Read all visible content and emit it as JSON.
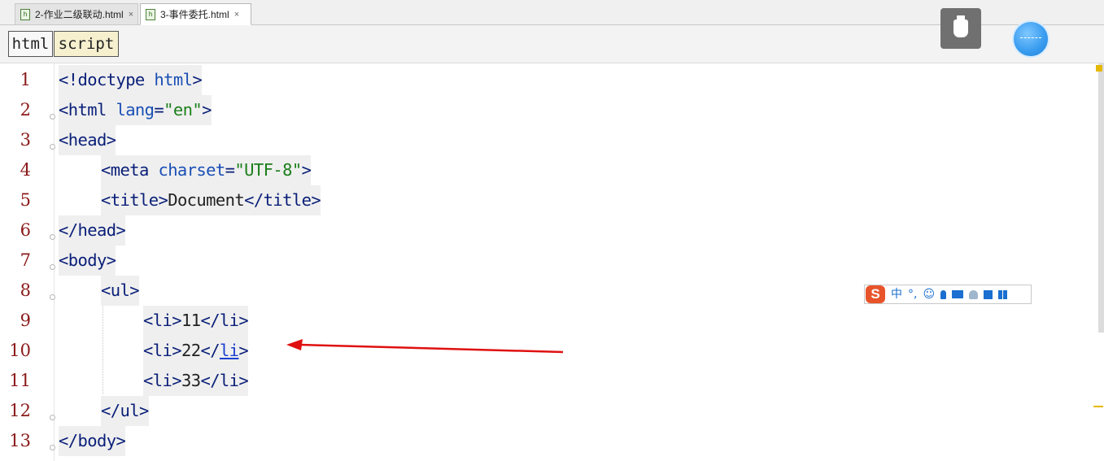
{
  "tabs": [
    {
      "label": "2-作业二级联动.html",
      "close": "×",
      "active": false
    },
    {
      "label": "3-事件委托.html",
      "close": "×",
      "active": true
    }
  ],
  "file_icon_letter": "h",
  "mode_buttons": {
    "html": "html",
    "script": "script"
  },
  "editor": {
    "line_numbers": [
      "1",
      "2",
      "3",
      "4",
      "5",
      "6",
      "7",
      "8",
      "9",
      "10",
      "11",
      "12",
      "13"
    ]
  },
  "ime_toolbar": {
    "logo": "S",
    "lang": "中",
    "punct": "°,"
  },
  "colors": {
    "line_number": "#8b1a1a",
    "tag": "#0a1f78",
    "attribute": "#1a4fb5",
    "string": "#1a7f1a",
    "arrow": "#e01010",
    "script_button_bg": "#f6f0cf"
  },
  "icons": {
    "usb": "usb-drive-icon",
    "assistant": "floating-ball-icon",
    "arrow": "red-arrow-annotation"
  }
}
